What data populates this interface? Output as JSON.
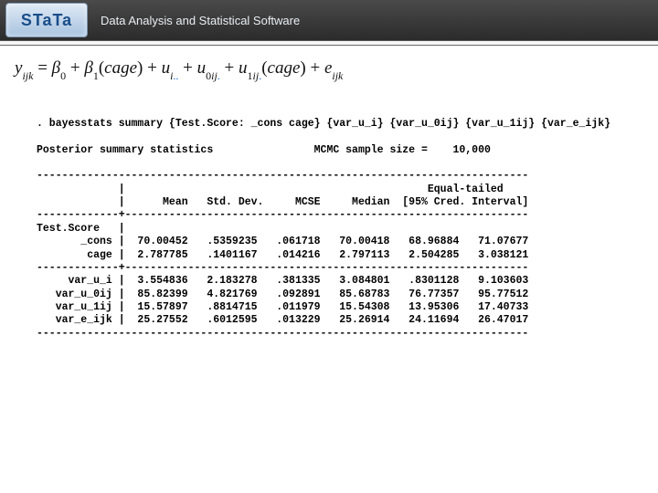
{
  "header": {
    "logo_text": "STaTa",
    "tagline": "Data Analysis and Statistical Software"
  },
  "equation": {
    "html": "<i>y</i><span class='sub'><i>ijk</i></span> = <i>β</i><span class='sub'>0</span> + <i>β</i><span class='sub'>1</span>(<i>cage</i>) + <i>u</i><span class='sub'><i>i</i><span class='blue'>..</span></span> + <i>u</i><span class='sub'>0<i>ij</i><span class='blue'>.</span></span> + <i>u</i><span class='sub'>1<i>ij</i><span class='blue'>.</span></span>(<i>cage</i>) + <i>e</i><span class='sub'><i>ijk</i></span>"
  },
  "cmd": ". bayesstats summary {Test.Score: _cons cage} {var_u_i} {var_u_0ij} {var_u_1ij} {var_e_ijk}",
  "posterior_label": "Posterior summary statistics",
  "mcmc_label": "MCMC sample size =",
  "mcmc_n": "10,000",
  "hdr_dashes": "------------------------------------------------------------------------------",
  "col_hdr1": "             |                                                Equal-tailed",
  "col_hdr2": "             |      Mean   Std. Dev.     MCSE     Median  [95% Cred. Interval]",
  "sep1": "-------------+----------------------------------------------------------------",
  "group_hdr": "Test.Score   |",
  "rows_top": [
    "       _cons |  70.00452   .5359235   .061718   70.00418   68.96884   71.07677",
    "        cage |  2.787785   .1401167   .014216   2.797113   2.504285   3.038121"
  ],
  "sep2": "-------------+----------------------------------------------------------------",
  "rows_bot": [
    "     var_u_i |  3.554836   2.183278   .381335   3.084801   .8301128   9.103603",
    "   var_u_0ij |  85.82399   4.821769   .092891   85.68783   76.77357   95.77512",
    "   var_u_1ij |  15.57897   .8814715   .011979   15.54308   13.95306   17.40733",
    "   var_e_ijk |  25.27552   .6012595   .013229   25.26914   24.11694   26.47017"
  ],
  "ftr_dashes": "------------------------------------------------------------------------------"
}
